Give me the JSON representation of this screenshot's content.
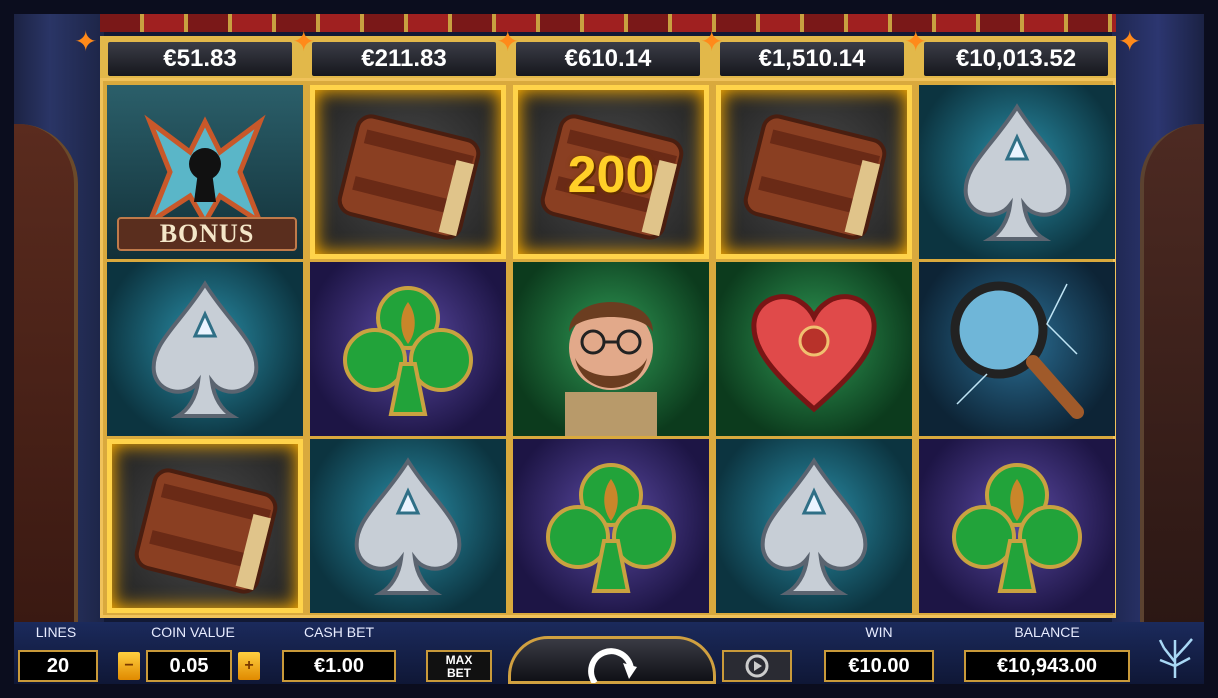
{
  "prizes": [
    "€51.83",
    "€211.83",
    "€610.14",
    "€1,510.14",
    "€10,013.52"
  ],
  "reels": [
    [
      {
        "symbol": "bonus-keyhole",
        "label": "BONUS",
        "bg": "bonus",
        "highlight": false
      },
      {
        "symbol": "spade",
        "bg": "teal",
        "highlight": false
      },
      {
        "symbol": "book",
        "bg": "wood",
        "highlight": true
      }
    ],
    [
      {
        "symbol": "book",
        "bg": "wood",
        "highlight": true
      },
      {
        "symbol": "club",
        "bg": "purple",
        "highlight": false
      },
      {
        "symbol": "spade",
        "bg": "teal",
        "highlight": false
      }
    ],
    [
      {
        "symbol": "book",
        "bg": "wood",
        "highlight": true,
        "win": "200"
      },
      {
        "symbol": "detective",
        "bg": "green",
        "highlight": false
      },
      {
        "symbol": "club",
        "bg": "purple",
        "highlight": false
      }
    ],
    [
      {
        "symbol": "book",
        "bg": "wood",
        "highlight": true
      },
      {
        "symbol": "heart",
        "bg": "green",
        "highlight": false
      },
      {
        "symbol": "spade",
        "bg": "teal",
        "highlight": false
      }
    ],
    [
      {
        "symbol": "spade",
        "bg": "teal",
        "highlight": false
      },
      {
        "symbol": "magnifier",
        "bg": "glass",
        "highlight": false
      },
      {
        "symbol": "club",
        "bg": "purple",
        "highlight": false
      }
    ]
  ],
  "controls": {
    "lines_label": "LINES",
    "lines_value": "20",
    "coin_label": "COIN VALUE",
    "coin_value": "0.05",
    "coin_minus": "−",
    "coin_plus": "+",
    "cashbet_label": "CASH BET",
    "cashbet_value": "€1.00",
    "maxbet_label_1": "MAX",
    "maxbet_label_2": "BET",
    "win_label": "WIN",
    "win_value": "€10.00",
    "balance_label": "BALANCE",
    "balance_value": "€10,943.00"
  },
  "colors": {
    "gold": "#e2b84a",
    "highlight": "#ffd34a",
    "win_text": "#ffd028"
  }
}
